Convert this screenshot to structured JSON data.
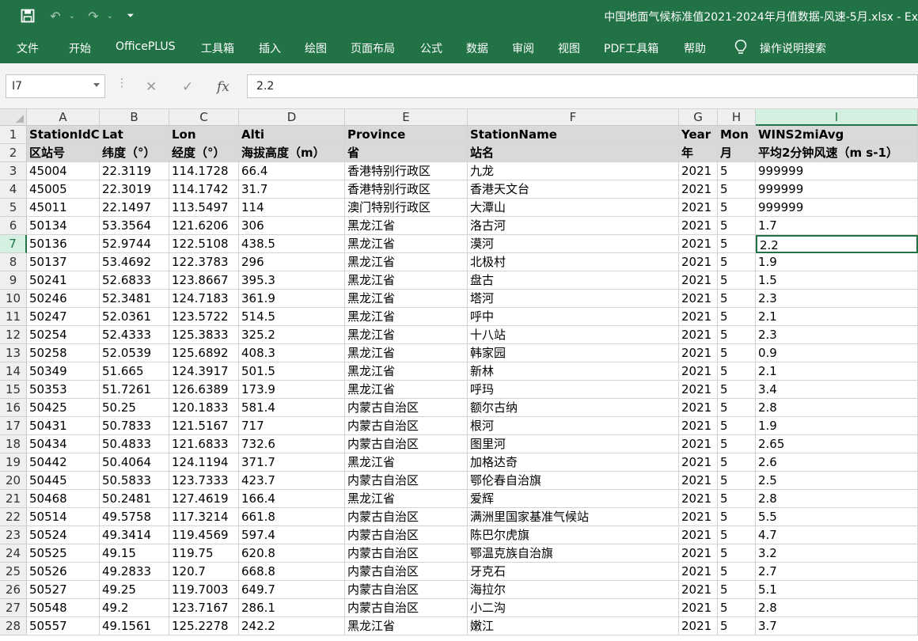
{
  "app": {
    "doc_title": "中国地面气候标准值2021-2024年月值数据-风速-5月.xlsx  -  Ex",
    "tabs": [
      "文件",
      "开始",
      "OfficePLUS",
      "工具箱",
      "插入",
      "绘图",
      "页面布局",
      "公式",
      "数据",
      "审阅",
      "视图",
      "PDF工具箱",
      "帮助"
    ],
    "search_label": "操作说明搜索"
  },
  "formula_bar": {
    "name_box": "I7",
    "cancel": "✕",
    "enter": "✓",
    "fx": "fx",
    "value": "2.2"
  },
  "sheet": {
    "columns": [
      "A",
      "B",
      "C",
      "D",
      "E",
      "F",
      "G",
      "H",
      "I"
    ],
    "row_numbers": [
      "1",
      "2",
      "3",
      "4",
      "5",
      "6",
      "7",
      "8",
      "9",
      "10",
      "11",
      "12",
      "13",
      "14",
      "15",
      "16",
      "17",
      "18",
      "19",
      "20",
      "21",
      "22",
      "23",
      "24",
      "25",
      "26",
      "27",
      "28"
    ],
    "header_en": [
      "StationIdC",
      "Lat",
      "Lon",
      "Alti",
      "Province",
      "StationName",
      "Year",
      "Mon",
      "WINS2miAvg"
    ],
    "header_cn": [
      "区站号",
      "纬度（°）",
      "经度（°）",
      "海拔高度（m）",
      "省",
      "站名",
      "年",
      "月",
      "平均2分钟风速（m s-1）"
    ],
    "rows": [
      [
        "45004",
        "22.3119",
        "114.1728",
        "66.4",
        "香港特别行政区",
        "九龙",
        "2021",
        "5",
        "999999"
      ],
      [
        "45005",
        "22.3019",
        "114.1742",
        "31.7",
        "香港特别行政区",
        "香港天文台",
        "2021",
        "5",
        "999999"
      ],
      [
        "45011",
        "22.1497",
        "113.5497",
        "114",
        "澳门特别行政区",
        "大潭山",
        "2021",
        "5",
        "999999"
      ],
      [
        "50134",
        "53.3564",
        "121.6206",
        "306",
        "黑龙江省",
        "洛古河",
        "2021",
        "5",
        "1.7"
      ],
      [
        "50136",
        "52.9744",
        "122.5108",
        "438.5",
        "黑龙江省",
        "漠河",
        "2021",
        "5",
        "2.2"
      ],
      [
        "50137",
        "53.4692",
        "122.3783",
        "296",
        "黑龙江省",
        "北极村",
        "2021",
        "5",
        "1.9"
      ],
      [
        "50241",
        "52.6833",
        "123.8667",
        "395.3",
        "黑龙江省",
        "盘古",
        "2021",
        "5",
        "1.5"
      ],
      [
        "50246",
        "52.3481",
        "124.7183",
        "361.9",
        "黑龙江省",
        "塔河",
        "2021",
        "5",
        "2.3"
      ],
      [
        "50247",
        "52.0361",
        "123.5722",
        "514.5",
        "黑龙江省",
        "呼中",
        "2021",
        "5",
        "2.1"
      ],
      [
        "50254",
        "52.4333",
        "125.3833",
        "325.2",
        "黑龙江省",
        "十八站",
        "2021",
        "5",
        "2.3"
      ],
      [
        "50258",
        "52.0539",
        "125.6892",
        "408.3",
        "黑龙江省",
        "韩家园",
        "2021",
        "5",
        "0.9"
      ],
      [
        "50349",
        "51.665",
        "124.3917",
        "501.5",
        "黑龙江省",
        "新林",
        "2021",
        "5",
        "2.1"
      ],
      [
        "50353",
        "51.7261",
        "126.6389",
        "173.9",
        "黑龙江省",
        "呼玛",
        "2021",
        "5",
        "3.4"
      ],
      [
        "50425",
        "50.25",
        "120.1833",
        "581.4",
        "内蒙古自治区",
        "额尔古纳",
        "2021",
        "5",
        "2.8"
      ],
      [
        "50431",
        "50.7833",
        "121.5167",
        "717",
        "内蒙古自治区",
        "根河",
        "2021",
        "5",
        "1.9"
      ],
      [
        "50434",
        "50.4833",
        "121.6833",
        "732.6",
        "内蒙古自治区",
        "图里河",
        "2021",
        "5",
        "2.65"
      ],
      [
        "50442",
        "50.4064",
        "124.1194",
        "371.7",
        "黑龙江省",
        "加格达奇",
        "2021",
        "5",
        "2.6"
      ],
      [
        "50445",
        "50.5833",
        "123.7333",
        "423.7",
        "内蒙古自治区",
        "鄂伦春自治旗",
        "2021",
        "5",
        "2.5"
      ],
      [
        "50468",
        "50.2481",
        "127.4619",
        "166.4",
        "黑龙江省",
        "爱辉",
        "2021",
        "5",
        "2.8"
      ],
      [
        "50514",
        "49.5758",
        "117.3214",
        "661.8",
        "内蒙古自治区",
        "满洲里国家基准气候站",
        "2021",
        "5",
        "5.5"
      ],
      [
        "50524",
        "49.3414",
        "119.4569",
        "597.4",
        "内蒙古自治区",
        "陈巴尔虎旗",
        "2021",
        "5",
        "4.7"
      ],
      [
        "50525",
        "49.15",
        "119.75",
        "620.8",
        "内蒙古自治区",
        "鄂温克族自治旗",
        "2021",
        "5",
        "3.2"
      ],
      [
        "50526",
        "49.2833",
        "120.7",
        "668.8",
        "内蒙古自治区",
        "牙克石",
        "2021",
        "5",
        "2.7"
      ],
      [
        "50527",
        "49.25",
        "119.7003",
        "649.7",
        "内蒙古自治区",
        "海拉尔",
        "2021",
        "5",
        "5.1"
      ],
      [
        "50548",
        "49.2",
        "123.7167",
        "286.1",
        "内蒙古自治区",
        "小二沟",
        "2021",
        "5",
        "2.8"
      ],
      [
        "50557",
        "49.1561",
        "125.2278",
        "242.2",
        "黑龙江省",
        "嫩江",
        "2021",
        "5",
        "3.7"
      ]
    ],
    "active_cell": "I7"
  }
}
